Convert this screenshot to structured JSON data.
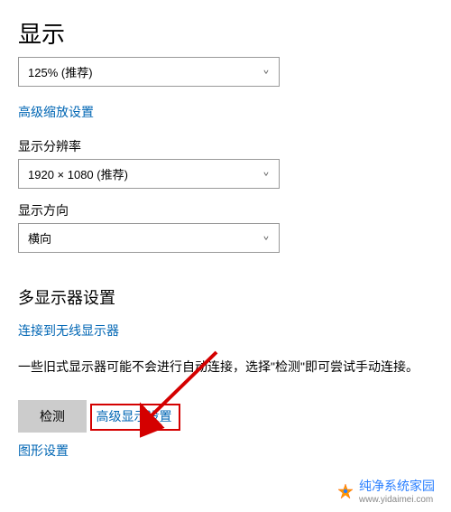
{
  "header": {
    "title": "显示"
  },
  "scale": {
    "dropdown_value": "125% (推荐)",
    "advanced_link": "高级缩放设置"
  },
  "resolution": {
    "label": "显示分辨率",
    "dropdown_value": "1920 × 1080 (推荐)"
  },
  "orientation": {
    "label": "显示方向",
    "dropdown_value": "横向"
  },
  "multi_display": {
    "title": "多显示器设置",
    "connect_link": "连接到无线显示器",
    "description": "一些旧式显示器可能不会进行自动连接，选择\"检测\"即可尝试手动连接。",
    "detect_button": "检测",
    "advanced_link": "高级显示设置",
    "graphics_link": "图形设置"
  },
  "footer": {
    "brand": "纯净系统家园",
    "url": "www.yidaimei.com"
  }
}
